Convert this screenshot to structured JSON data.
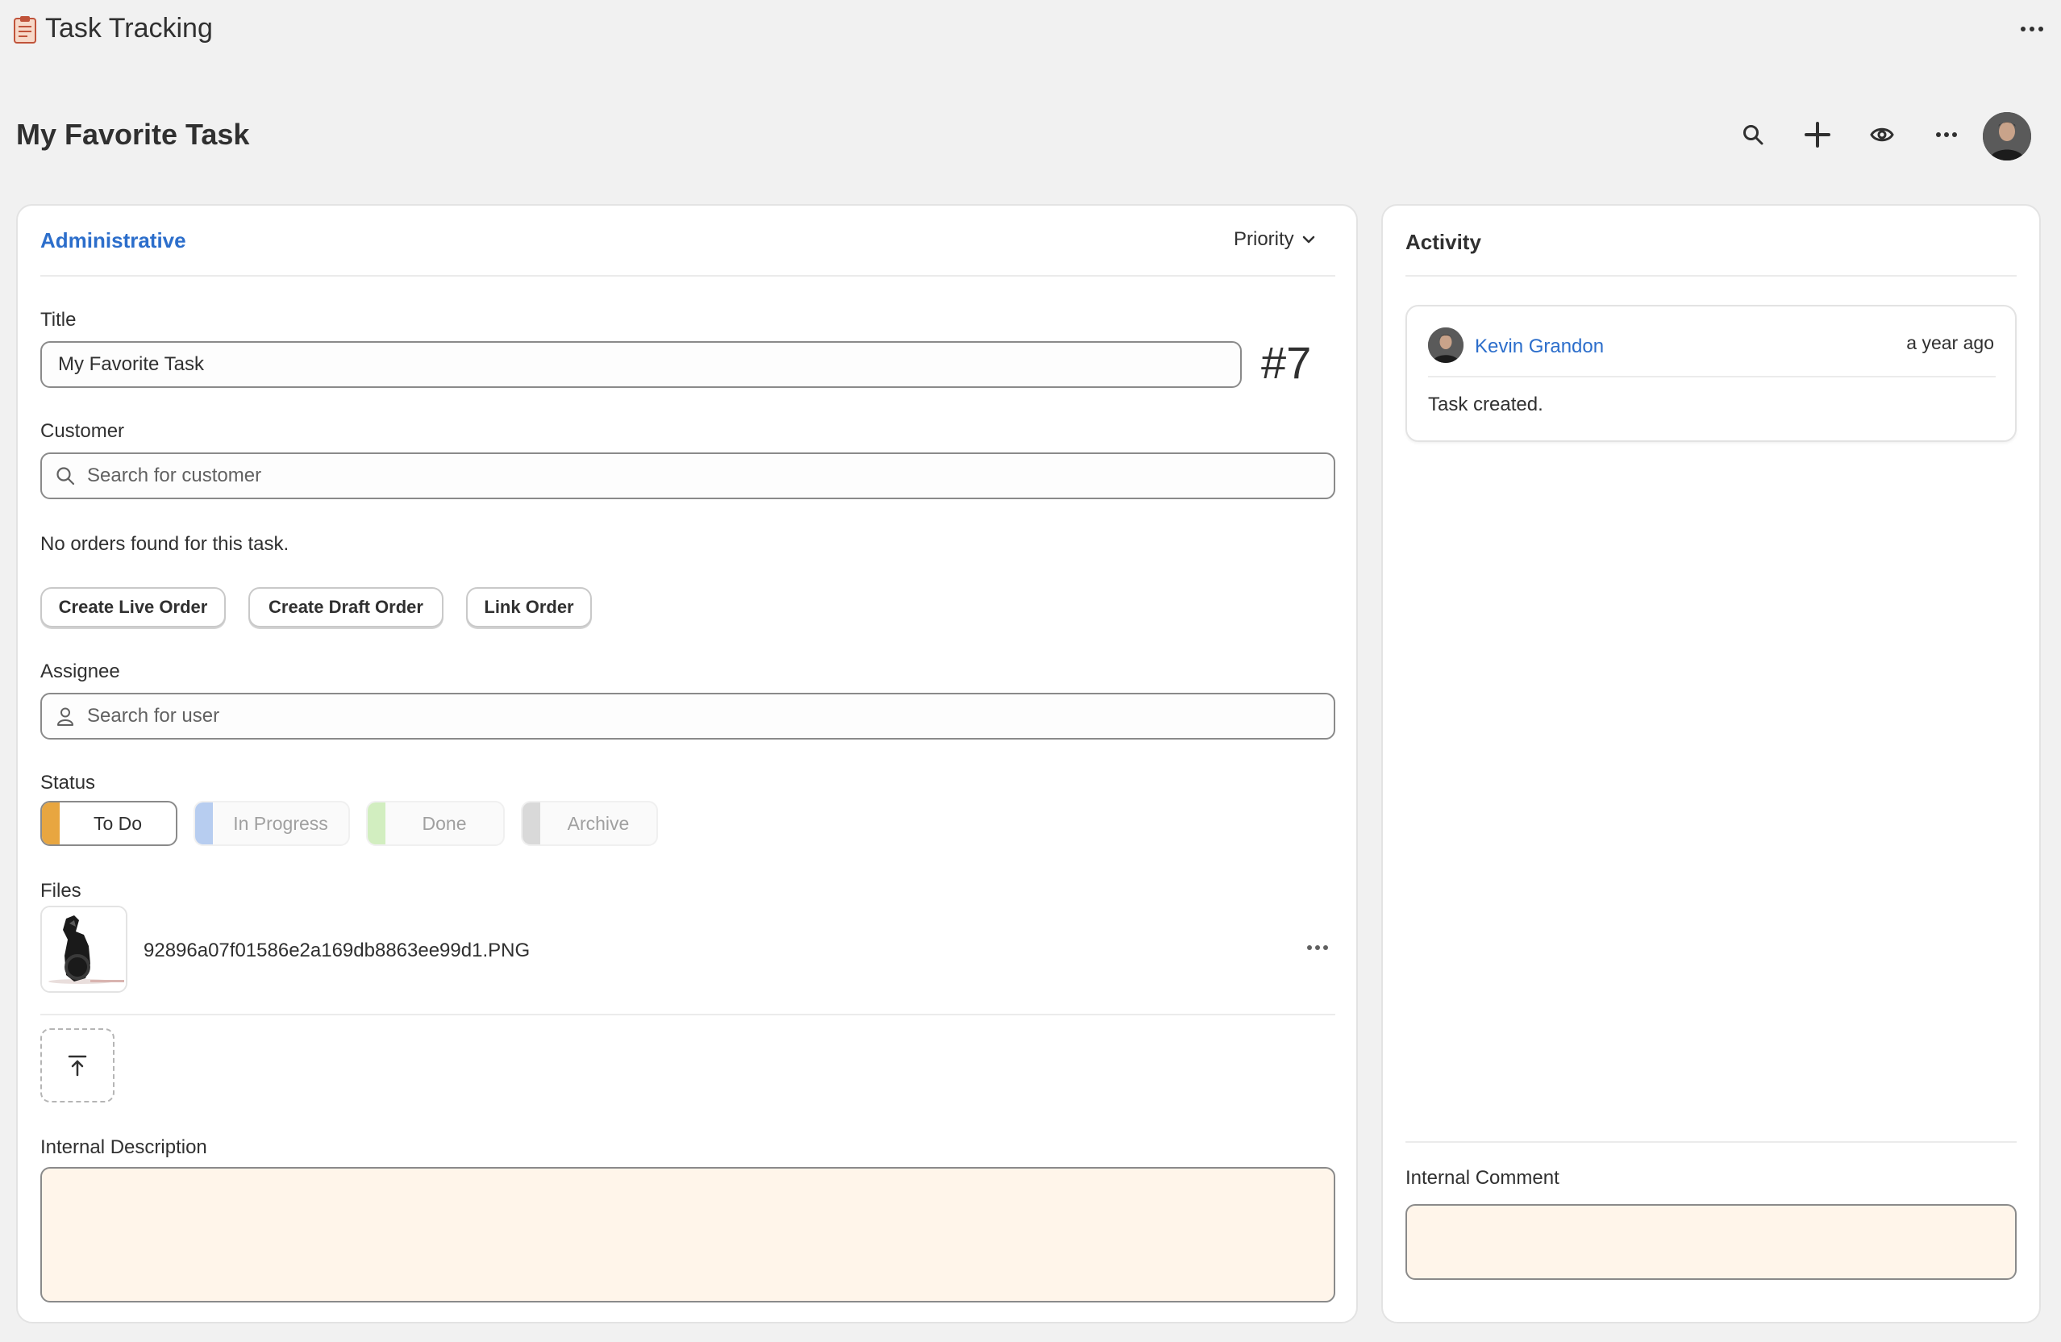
{
  "app": {
    "title": "Task Tracking",
    "icon": "clipboard-icon"
  },
  "page": {
    "title": "My Favorite Task"
  },
  "header_actions": [
    "search-icon",
    "plus-icon",
    "eye-icon",
    "more-icon",
    "avatar"
  ],
  "task": {
    "category": "Administrative",
    "priority_label": "Priority",
    "title_label": "Title",
    "title_value": "My Favorite Task",
    "number": "#7",
    "customer_label": "Customer",
    "customer_placeholder": "Search for customer",
    "orders_empty": "No orders found for this task.",
    "order_buttons": {
      "create_live": "Create Live Order",
      "create_draft": "Create Draft Order",
      "link": "Link Order"
    },
    "assignee_label": "Assignee",
    "assignee_placeholder": "Search for user",
    "status_label": "Status",
    "statuses": [
      {
        "label": "To Do",
        "color": "#e8a640",
        "selected": true
      },
      {
        "label": "In Progress",
        "color": "#b7cdf0",
        "selected": false
      },
      {
        "label": "Done",
        "color": "#d2eec0",
        "selected": false
      },
      {
        "label": "Archive",
        "color": "#d9d9d9",
        "selected": false
      }
    ],
    "files_label": "Files",
    "file_name": "92896a07f01586e2a169db8863ee99d1.PNG",
    "internal_description_label": "Internal Description"
  },
  "activity": {
    "title": "Activity",
    "entries": [
      {
        "user": "Kevin Grandon",
        "time": "a year ago",
        "text": "Task created."
      }
    ],
    "comment_label": "Internal Comment"
  },
  "colors": {
    "accent_link": "#2c6ecb",
    "background": "#f1f1f1",
    "textarea_bg": "#fff5ea"
  }
}
